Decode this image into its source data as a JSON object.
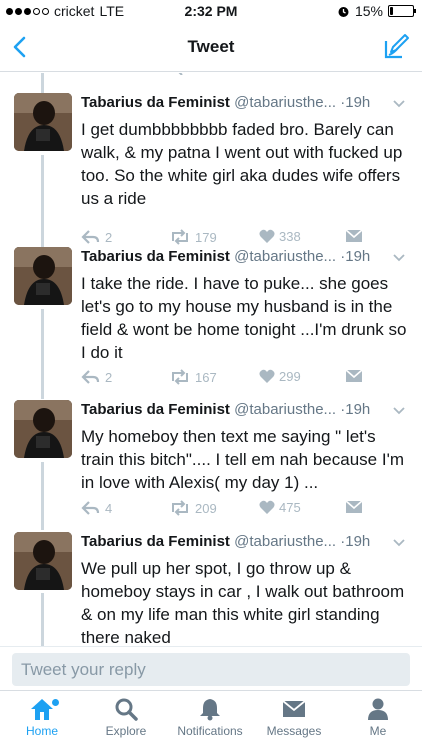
{
  "status_bar": {
    "carrier": "cricket",
    "network": "LTE",
    "time": "2:32 PM",
    "battery": "15%",
    "battery_level": 0.15
  },
  "nav": {
    "title": "Tweet",
    "back_icon": "chevron-left-icon",
    "compose_icon": "compose-icon",
    "accent": "#1da1f2"
  },
  "tweets": [
    {
      "name": "Tabarius da Feminist",
      "handle": "@tabariusthe...",
      "separator": "·",
      "time": "19h",
      "text": "I get dumbbbbbbbb faded bro. Barely can walk, & my patna I went out with fucked up too. So the white girl aka dudes wife offers us a ride",
      "replies": "2",
      "retweets": "179",
      "likes": "338"
    },
    {
      "name": "Tabarius da Feminist",
      "handle": "@tabariusthe...",
      "separator": "·",
      "time": "19h",
      "text": "I take the ride. I have to puke... she goes let's go to my house my husband is in the field & wont be home tonight ...I'm drunk so I do it",
      "replies": "2",
      "retweets": "167",
      "likes": "299"
    },
    {
      "name": "Tabarius da Feminist",
      "handle": "@tabariusthe...",
      "separator": "·",
      "time": "19h",
      "text": "My homeboy then text me saying \" let's train this bitch\".... I tell em nah because I'm in love with Alexis( my day 1) ...",
      "replies": "4",
      "retweets": "209",
      "likes": "475"
    },
    {
      "name": "Tabarius da Feminist",
      "handle": "@tabariusthe...",
      "separator": "·",
      "time": "19h",
      "text": "We pull up her spot, I go throw up & homeboy stays in car , I walk out bathroom & on my life man this white girl standing there naked"
    }
  ],
  "reply": {
    "placeholder": "Tweet your reply"
  },
  "tabs": [
    {
      "label": "Home",
      "icon": "home-icon",
      "active": true
    },
    {
      "label": "Explore",
      "icon": "search-icon",
      "active": false
    },
    {
      "label": "Notifications",
      "icon": "bell-icon",
      "active": false
    },
    {
      "label": "Messages",
      "icon": "envelope-icon",
      "active": false
    },
    {
      "label": "Me",
      "icon": "person-icon",
      "active": false
    }
  ]
}
